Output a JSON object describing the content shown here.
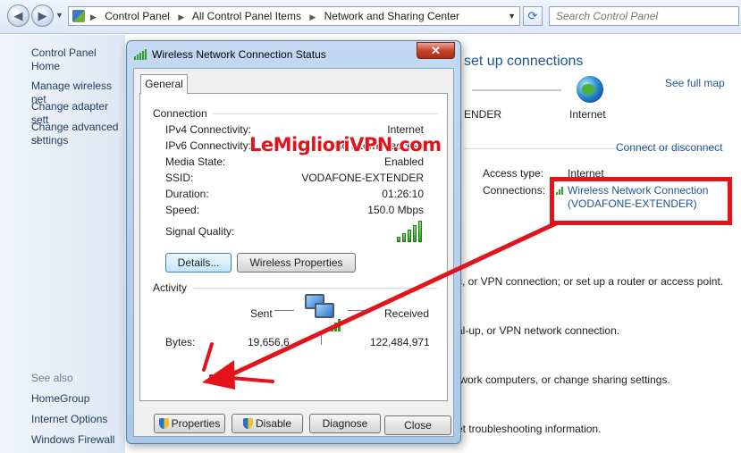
{
  "address_bar": {
    "breadcrumbs": [
      "Control Panel",
      "All Control Panel Items",
      "Network and Sharing Center"
    ],
    "search_placeholder": "Search Control Panel"
  },
  "sidebar": {
    "items": [
      {
        "label": "Control Panel Home"
      },
      {
        "label": "Manage wireless net"
      },
      {
        "label": "Change adapter sett"
      },
      {
        "label": "Change advanced sl"
      },
      {
        "label": "settings"
      }
    ],
    "see_also_label": "See also",
    "see_also": [
      {
        "label": "HomeGroup"
      },
      {
        "label": "Internet Options"
      },
      {
        "label": "Windows Firewall"
      }
    ]
  },
  "main": {
    "heading": "set up connections",
    "see_full_map": "See full map",
    "network_node_label": "ENDER",
    "internet_label": "Internet",
    "connect_link": "Connect or disconnect",
    "access_type_label": "Access type:",
    "access_type_value": "Internet",
    "connections_label": "Connections:",
    "connection_link_line1": "Wireless Network Connection",
    "connection_link_line2": "(VODAFONE-EXTENDER)",
    "tasks": [
      "c, or VPN connection; or set up a router or access point.",
      "al-up, or VPN network connection.",
      "twork computers, or change sharing settings.",
      "et troubleshooting information."
    ]
  },
  "dialog": {
    "title": "Wireless Network Connection Status",
    "close_glyph": "✕",
    "tab": "General",
    "connection_group": "Connection",
    "rows": [
      {
        "label": "IPv4 Connectivity:",
        "value": "Internet"
      },
      {
        "label": "IPv6 Connectivity:",
        "value": "No Internet access"
      },
      {
        "label": "Media State:",
        "value": "Enabled"
      },
      {
        "label": "SSID:",
        "value": "VODAFONE-EXTENDER"
      },
      {
        "label": "Duration:",
        "value": "01:26:10"
      },
      {
        "label": "Speed:",
        "value": "150.0 Mbps"
      }
    ],
    "signal_label": "Signal Quality:",
    "signal_bars": 5,
    "details_button": "Details...",
    "wireless_properties_button": "Wireless Properties",
    "activity_group": "Activity",
    "sent_label": "Sent",
    "received_label": "Received",
    "bytes_label": "Bytes:",
    "bytes_sent": "19,656,6..",
    "bytes_received": "122,484,971",
    "properties_button": "Properties",
    "disable_button": "Disable",
    "diagnose_button": "Diagnose",
    "close_button": "Close"
  },
  "watermark": "LeMiglioriVPN.com",
  "colors": {
    "link": "#1d5496",
    "annotation_red": "#e3131b",
    "dialog_frame": "#a9c8e8"
  }
}
